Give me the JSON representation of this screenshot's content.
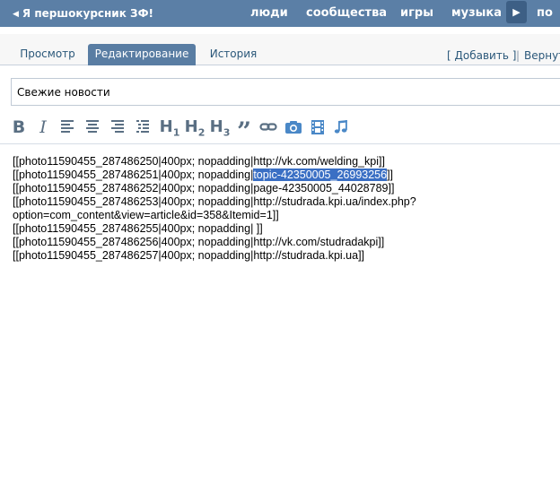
{
  "topbar": {
    "back_label": "Я першокурсник ЗФ!",
    "nav": [
      "люди",
      "сообщества",
      "игры",
      "музыка",
      "по"
    ]
  },
  "tabs": {
    "items": [
      {
        "label": "Просмотр",
        "active": false
      },
      {
        "label": "Редактирование",
        "active": true
      },
      {
        "label": "История",
        "active": false
      }
    ],
    "add_label": "[ Добавить ]",
    "separator": "|",
    "return_label": "Вернут"
  },
  "editor": {
    "title_value": "Свежие новости",
    "toolbar": [
      {
        "name": "bold-button",
        "glyph": "B"
      },
      {
        "name": "italic-button",
        "glyph": "I"
      },
      {
        "name": "align-left-button",
        "icon": "align-left-icon"
      },
      {
        "name": "align-center-button",
        "icon": "align-center-icon"
      },
      {
        "name": "align-right-button",
        "icon": "align-right-icon"
      },
      {
        "name": "list-button",
        "icon": "list-icon"
      },
      {
        "name": "h1-button",
        "glyph": "H",
        "sub": "1"
      },
      {
        "name": "h2-button",
        "glyph": "H",
        "sub": "2"
      },
      {
        "name": "h3-button",
        "glyph": "H",
        "sub": "3"
      },
      {
        "name": "quote-button",
        "glyph": "”"
      },
      {
        "name": "link-button",
        "icon": "link-icon"
      },
      {
        "name": "photo-button",
        "icon": "camera-icon"
      },
      {
        "name": "video-button",
        "icon": "film-icon"
      },
      {
        "name": "audio-button",
        "icon": "music-note-icon"
      }
    ],
    "lines": [
      {
        "text": "[[photo11590455_287486250|400px; nopadding|http://vk.com/welding_kpi]]"
      },
      {
        "pre": "[[photo11590455_287486251|400px; nopadding|",
        "selected": "topic-42350005_26993256",
        "post": "]]"
      },
      {
        "text": "[[photo11590455_287486252|400px; nopadding|page-42350005_44028789]]"
      },
      {
        "text": "[[photo11590455_287486253|400px; nopadding|http://studrada.kpi.ua/index.php?"
      },
      {
        "text": "option=com_content&view=article&id=358&Itemid=1]]"
      },
      {
        "text": "[[photo11590455_287486255|400px; nopadding| ]]"
      },
      {
        "text": "[[photo11590455_287486256|400px; nopadding|http://vk.com/studradakpi]]"
      },
      {
        "text": "[[photo11590455_287486257|400px; nopadding|http://studrada.kpi.ua]]"
      }
    ]
  },
  "colors": {
    "topbar": "#5b7fa6",
    "active_tab": "#597da3",
    "link": "#2b587a",
    "toolbar_icon": "#5a6f83",
    "media_icon": "#4a88c7",
    "selection": "#3a6fc4"
  }
}
